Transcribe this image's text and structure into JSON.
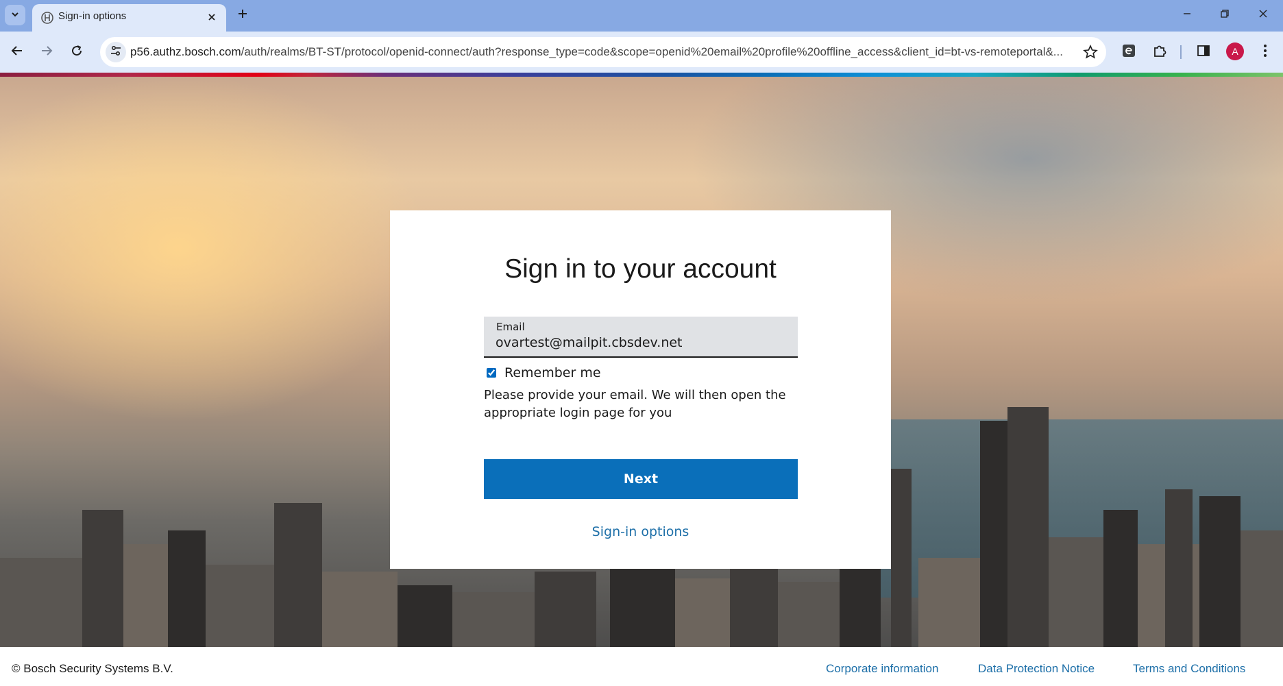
{
  "browser": {
    "tab_title": "Sign-in options",
    "url_host": "p56.authz.bosch.com",
    "url_path": "/auth/realms/BT-ST/protocol/openid-connect/auth?response_type=code&scope=openid%20email%20profile%20offline_access&client_id=bt-vs-remoteportal&...",
    "profile_initial": "A"
  },
  "login": {
    "title": "Sign in to your account",
    "email_label": "Email",
    "email_value": "ovartest@mailpit.cbsdev.net",
    "remember_label": "Remember me",
    "remember_checked": true,
    "hint": "Please provide your email. We will then open the appropriate login page for you",
    "next_label": "Next",
    "signin_options_label": "Sign-in options"
  },
  "footer": {
    "copyright": "© Bosch Security Systems B.V.",
    "links": [
      "Corporate information",
      "Data Protection Notice",
      "Terms and Conditions"
    ]
  },
  "colors": {
    "primary_button": "#0a6fba",
    "link": "#1d6fa8",
    "tabbar": "#87a9e3",
    "toolbar": "#dfe9fa"
  }
}
